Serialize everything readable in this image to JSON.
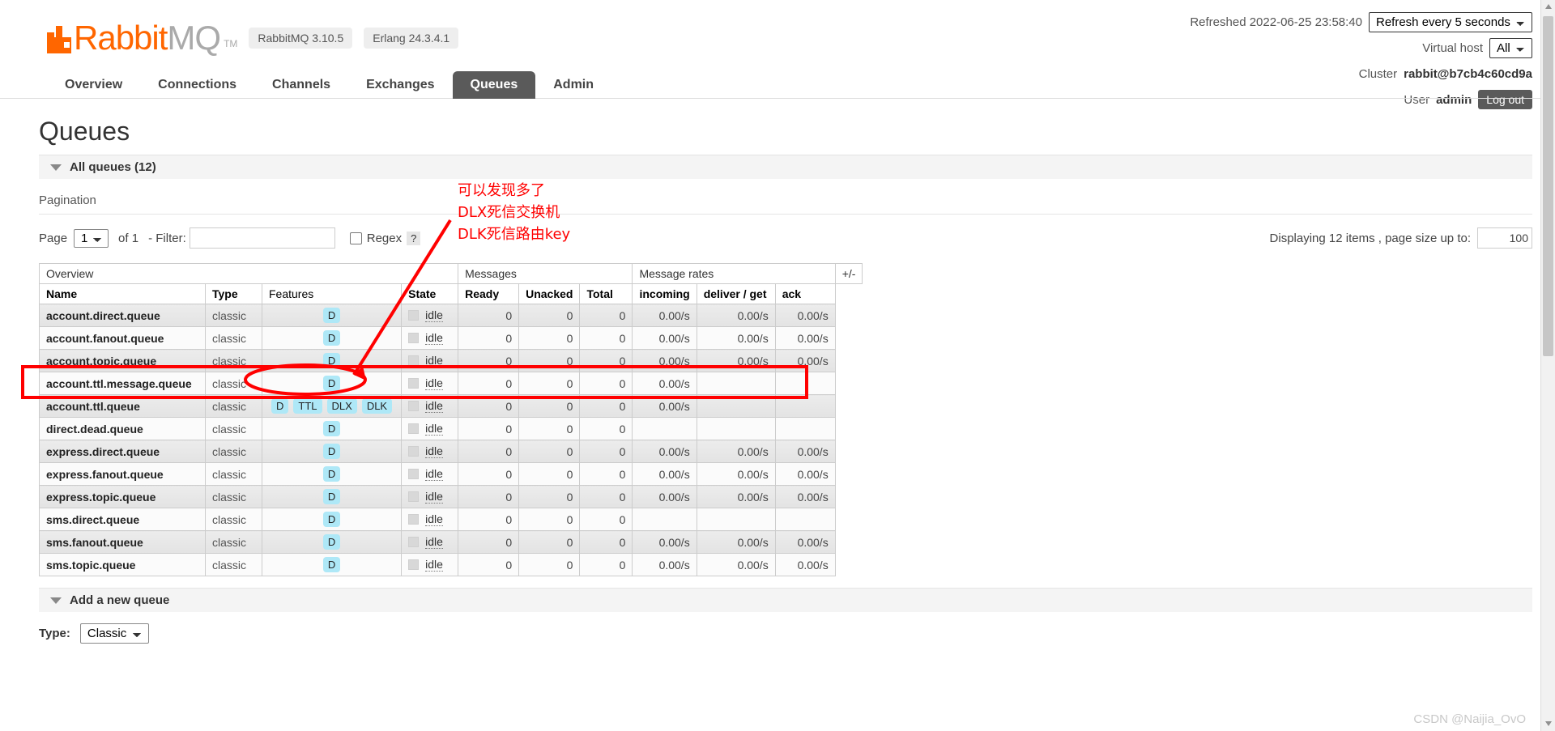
{
  "brand": {
    "name_primary": "Rabbit",
    "name_secondary": "MQ",
    "trademark": "TM",
    "version_pill": "RabbitMQ 3.10.5",
    "erlang_pill": "Erlang 24.3.4.1"
  },
  "header": {
    "refreshed_label": "Refreshed 2022-06-25 23:58:40",
    "refresh_select_value": "Refresh every 5 seconds",
    "vhost_label": "Virtual host",
    "vhost_select_value": "All",
    "cluster_label": "Cluster",
    "cluster_value": "rabbit@b7cb4c60cd9a",
    "user_label": "User",
    "user_value": "admin",
    "logout_label": "Log out"
  },
  "nav": {
    "tabs": [
      {
        "label": "Overview",
        "active": false
      },
      {
        "label": "Connections",
        "active": false
      },
      {
        "label": "Channels",
        "active": false
      },
      {
        "label": "Exchanges",
        "active": false
      },
      {
        "label": "Queues",
        "active": true
      },
      {
        "label": "Admin",
        "active": false
      }
    ]
  },
  "page": {
    "title": "Queues",
    "all_queues_label": "All queues (12)",
    "pagination_label": "Pagination"
  },
  "filters": {
    "page_label": "Page",
    "page_value": "1",
    "of_label": "of 1",
    "filter_label": "- Filter:",
    "filter_value": "",
    "filter_placeholder": "",
    "regex_label": "Regex",
    "regex_help": "?",
    "displaying_label": "Displaying 12 items , page size up to:",
    "page_size_value": "100"
  },
  "table": {
    "group_headers": [
      {
        "label": "Overview",
        "span": 4
      },
      {
        "label": "Messages",
        "span": 3
      },
      {
        "label": "Message rates",
        "span": 3
      }
    ],
    "plusminus": "+/-",
    "columns": [
      "Name",
      "Type",
      "Features",
      "State",
      "Ready",
      "Unacked",
      "Total",
      "incoming",
      "deliver / get",
      "ack"
    ],
    "rows": [
      {
        "name": "account.direct.queue",
        "type": "classic",
        "features": [
          "D"
        ],
        "state": "idle",
        "ready": "0",
        "unacked": "0",
        "total": "0",
        "incoming": "0.00/s",
        "deliver": "0.00/s",
        "ack": "0.00/s"
      },
      {
        "name": "account.fanout.queue",
        "type": "classic",
        "features": [
          "D"
        ],
        "state": "idle",
        "ready": "0",
        "unacked": "0",
        "total": "0",
        "incoming": "0.00/s",
        "deliver": "0.00/s",
        "ack": "0.00/s"
      },
      {
        "name": "account.topic.queue",
        "type": "classic",
        "features": [
          "D"
        ],
        "state": "idle",
        "ready": "0",
        "unacked": "0",
        "total": "0",
        "incoming": "0.00/s",
        "deliver": "0.00/s",
        "ack": "0.00/s"
      },
      {
        "name": "account.ttl.message.queue",
        "type": "classic",
        "features": [
          "D"
        ],
        "state": "idle",
        "ready": "0",
        "unacked": "0",
        "total": "0",
        "incoming": "0.00/s",
        "deliver": "",
        "ack": ""
      },
      {
        "name": "account.ttl.queue",
        "type": "classic",
        "features": [
          "D",
          "TTL",
          "DLX",
          "DLK"
        ],
        "state": "idle",
        "ready": "0",
        "unacked": "0",
        "total": "0",
        "incoming": "0.00/s",
        "deliver": "",
        "ack": ""
      },
      {
        "name": "direct.dead.queue",
        "type": "classic",
        "features": [
          "D"
        ],
        "state": "idle",
        "ready": "0",
        "unacked": "0",
        "total": "0",
        "incoming": "",
        "deliver": "",
        "ack": ""
      },
      {
        "name": "express.direct.queue",
        "type": "classic",
        "features": [
          "D"
        ],
        "state": "idle",
        "ready": "0",
        "unacked": "0",
        "total": "0",
        "incoming": "0.00/s",
        "deliver": "0.00/s",
        "ack": "0.00/s"
      },
      {
        "name": "express.fanout.queue",
        "type": "classic",
        "features": [
          "D"
        ],
        "state": "idle",
        "ready": "0",
        "unacked": "0",
        "total": "0",
        "incoming": "0.00/s",
        "deliver": "0.00/s",
        "ack": "0.00/s"
      },
      {
        "name": "express.topic.queue",
        "type": "classic",
        "features": [
          "D"
        ],
        "state": "idle",
        "ready": "0",
        "unacked": "0",
        "total": "0",
        "incoming": "0.00/s",
        "deliver": "0.00/s",
        "ack": "0.00/s"
      },
      {
        "name": "sms.direct.queue",
        "type": "classic",
        "features": [
          "D"
        ],
        "state": "idle",
        "ready": "0",
        "unacked": "0",
        "total": "0",
        "incoming": "",
        "deliver": "",
        "ack": ""
      },
      {
        "name": "sms.fanout.queue",
        "type": "classic",
        "features": [
          "D"
        ],
        "state": "idle",
        "ready": "0",
        "unacked": "0",
        "total": "0",
        "incoming": "0.00/s",
        "deliver": "0.00/s",
        "ack": "0.00/s"
      },
      {
        "name": "sms.topic.queue",
        "type": "classic",
        "features": [
          "D"
        ],
        "state": "idle",
        "ready": "0",
        "unacked": "0",
        "total": "0",
        "incoming": "0.00/s",
        "deliver": "0.00/s",
        "ack": "0.00/s"
      }
    ]
  },
  "add_queue": {
    "heading": "Add a new queue",
    "type_label": "Type:",
    "type_value": "Classic"
  },
  "annotation": {
    "text": "可以发现多了\nDLX死信交换机\nDLK死信路由key",
    "color": "#ff0000"
  },
  "watermark": "CSDN @Naijia_OvO",
  "colors": {
    "brand_orange": "#ff6600",
    "feature_badge": "#aee8f7",
    "active_tab": "#5a5a5a",
    "annotation_red": "#ff0000"
  }
}
